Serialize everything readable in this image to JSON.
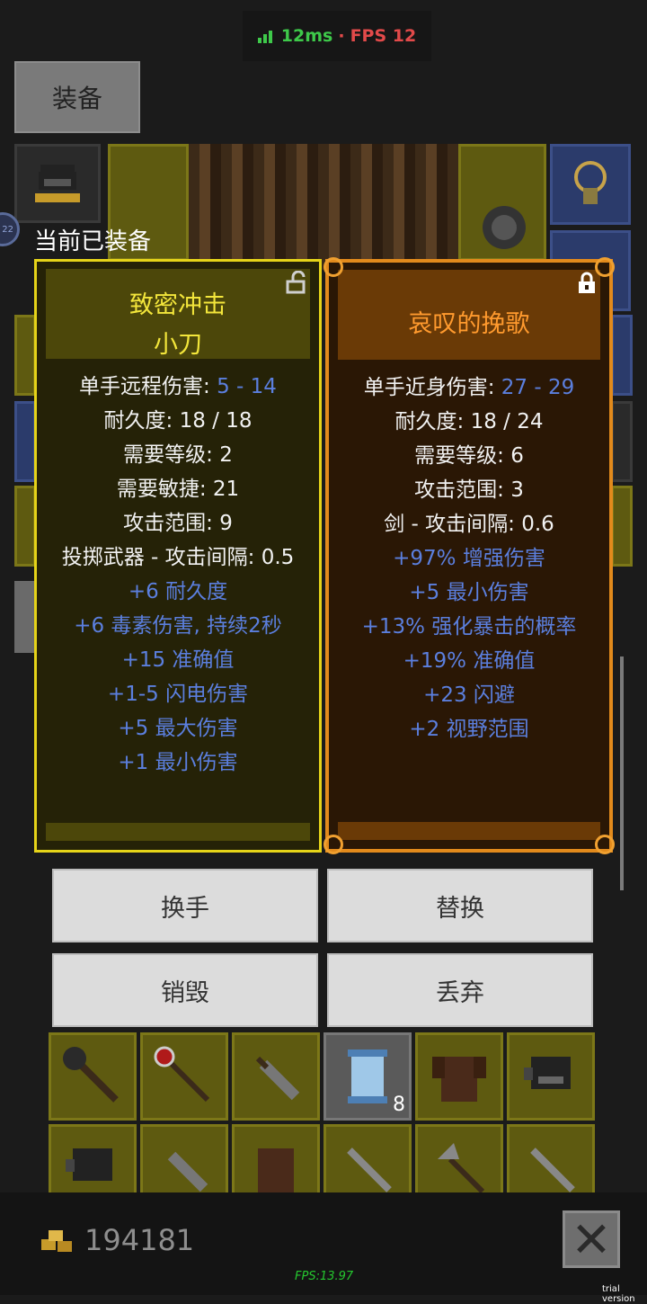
{
  "status": {
    "ping": "12ms",
    "separator": "·",
    "fps": "FPS 12"
  },
  "tab": {
    "label": "装备"
  },
  "equipped_caption": "当前已装备",
  "level_badge": "22",
  "left_card": {
    "name_line1": "致密冲击",
    "name_line2": "小刀",
    "stats": [
      {
        "label": "单手远程伤害: ",
        "value": "5 - 14"
      },
      {
        "label": "耐久度: 18 / 18"
      },
      {
        "label": "需要等级: 2"
      },
      {
        "label": "需要敏捷: 21"
      },
      {
        "label": "攻击范围: 9"
      },
      {
        "label": "投掷武器 - 攻击间隔: 0.5"
      }
    ],
    "bonuses": [
      "+6 耐久度",
      "+6 毒素伤害, 持续2秒",
      "+15 准确值",
      "+1-5 闪电伤害",
      "+5 最大伤害",
      "+1 最小伤害"
    ]
  },
  "right_card": {
    "name": "哀叹的挽歌",
    "stats": [
      {
        "label": "单手近身伤害: ",
        "value": "27 - 29"
      },
      {
        "label": "耐久度: 18 / 24"
      },
      {
        "label": "需要等级: 6"
      },
      {
        "label": "攻击范围: 3"
      },
      {
        "label": "剑 - 攻击间隔: 0.6"
      }
    ],
    "bonuses": [
      "+97% 增强伤害",
      "+5 最小伤害",
      "+13% 强化暴击的概率",
      "+19% 准确值",
      "+23 闪避",
      "+2 视野范围"
    ]
  },
  "buttons": {
    "swap_hand": "换手",
    "replace": "替换",
    "destroy": "销毁",
    "drop": "丢弃"
  },
  "inventory": {
    "scroll_count": "8",
    "items_row1": [
      "mace-icon",
      "staff-icon",
      "knife-icon",
      "scroll-icon",
      "leather-armor-icon",
      "helmet-icon"
    ],
    "items_row2": [
      "helmet-icon",
      "knife-icon",
      "leather-armor-icon",
      "sword-icon",
      "axe-icon",
      "sword-icon"
    ]
  },
  "gold": "194181",
  "fps_footer": "FPS:13.97",
  "trial": "trial version",
  "colors": {
    "left_accent": "#e6d419",
    "right_accent": "#e28a1c",
    "bonus": "#5b7fde"
  }
}
